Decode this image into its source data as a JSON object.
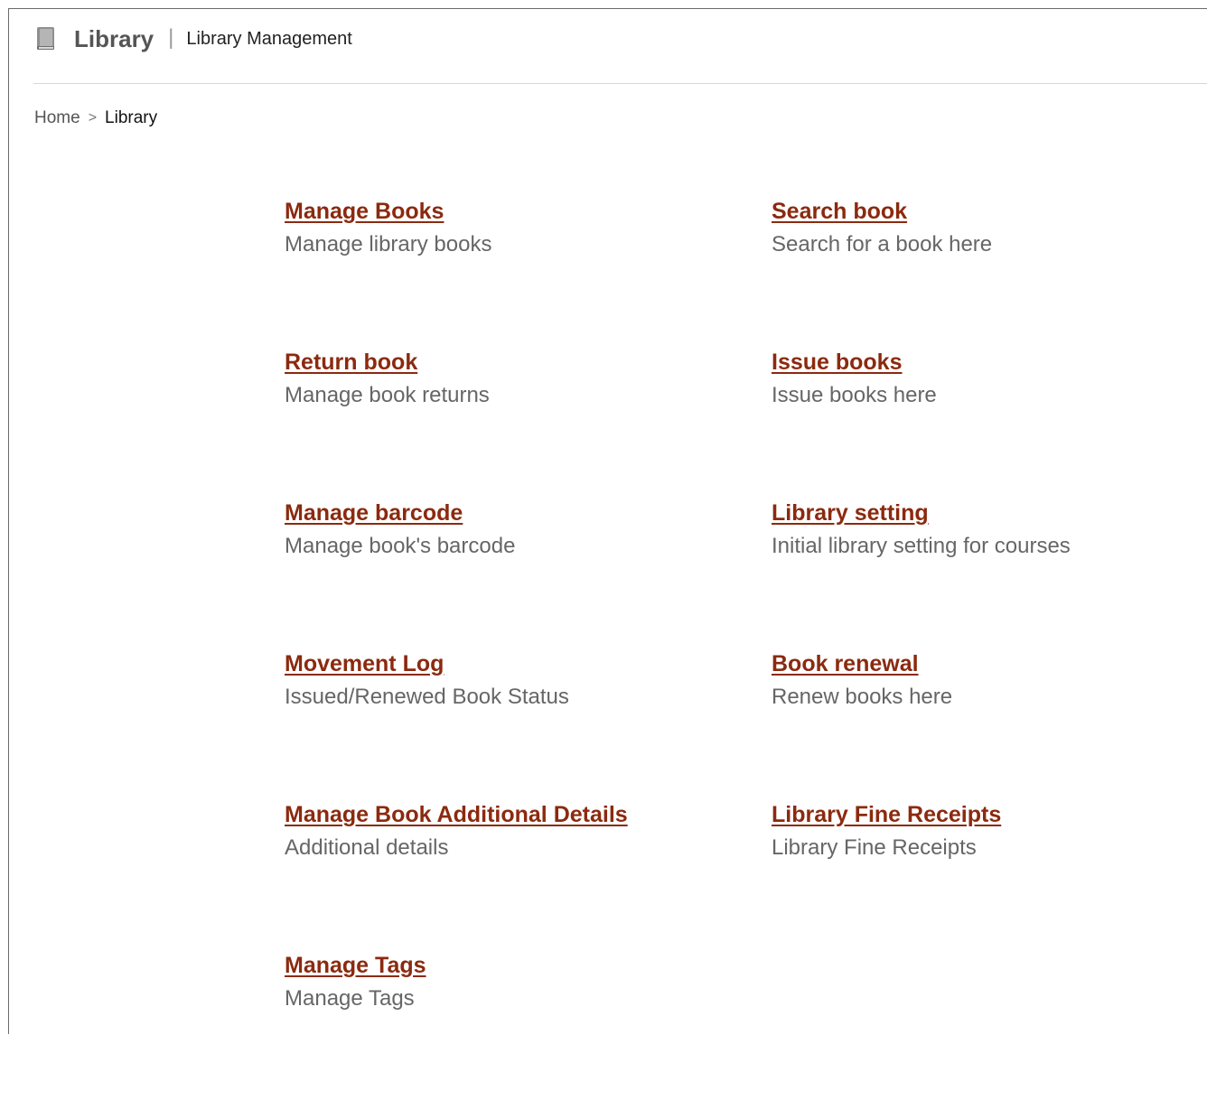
{
  "header": {
    "icon": "book-icon",
    "title": "Library",
    "separator": "|",
    "subtitle": "Library Management"
  },
  "breadcrumb": {
    "home": "Home",
    "separator": ">",
    "current": "Library"
  },
  "menu": [
    {
      "label": "Manage Books",
      "description": "Manage library books"
    },
    {
      "label": "Search book",
      "description": "Search for a book here"
    },
    {
      "label": "Return book",
      "description": "Manage book returns"
    },
    {
      "label": "Issue books",
      "description": "Issue books here"
    },
    {
      "label": "Manage barcode",
      "description": "Manage book's barcode"
    },
    {
      "label": "Library setting",
      "description": "Initial library setting for courses"
    },
    {
      "label": "Movement Log",
      "description": "Issued/Renewed Book Status"
    },
    {
      "label": "Book renewal",
      "description": "Renew books here"
    },
    {
      "label": "Manage Book Additional Details",
      "description": "Additional details"
    },
    {
      "label": "Library Fine Receipts",
      "description": "Library Fine Receipts"
    },
    {
      "label": "Manage Tags",
      "description": "Manage Tags"
    }
  ],
  "colors": {
    "link": "#8b2a0f",
    "description": "#666666",
    "title": "#555555"
  }
}
